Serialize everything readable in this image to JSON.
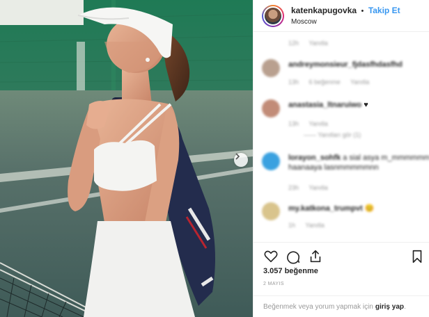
{
  "header": {
    "username": "katenkapugovka",
    "separator": "•",
    "follow_label": "Takip Et",
    "location": "Moscow"
  },
  "comments": [
    {
      "user": "",
      "text": "",
      "meta": [
        "12h",
        "Yanıtla"
      ]
    },
    {
      "user": "andreymonsieur_fjdasfhdasfhd",
      "text": "",
      "meta": [
        "13h",
        "6 beğenme",
        "Yanıtla"
      ]
    },
    {
      "user": "anastasia_ltnaruiwo",
      "text": "♥",
      "meta": [
        "13h",
        "Yanıtla"
      ],
      "replies": "—— Yanıtları gör (1)"
    },
    {
      "user": "lorayon_sohfk",
      "text": "a sial asya m_mmmmmm mn",
      "text2": "haanaaya lasnmmmmmnn",
      "meta": [
        "23h",
        "Yanıtla"
      ]
    },
    {
      "user": "my.katkona_trumpvt",
      "text": "😊",
      "meta": [
        "1h",
        "Yanıtla"
      ]
    }
  ],
  "actions": {
    "likes": "3.057 beğenme",
    "date": "2 MAYIS",
    "login_prompt": "Beğenmek veya yorum yapmak için",
    "login_link": "giriş yap",
    "login_suffix": "."
  },
  "icons": [
    "heart-icon",
    "comment-icon",
    "share-icon",
    "bookmark-icon",
    "chevron-right-icon"
  ],
  "colors": {
    "link": "#3897f0",
    "text": "#262626",
    "muted": "#999999",
    "border": "#efefef"
  }
}
